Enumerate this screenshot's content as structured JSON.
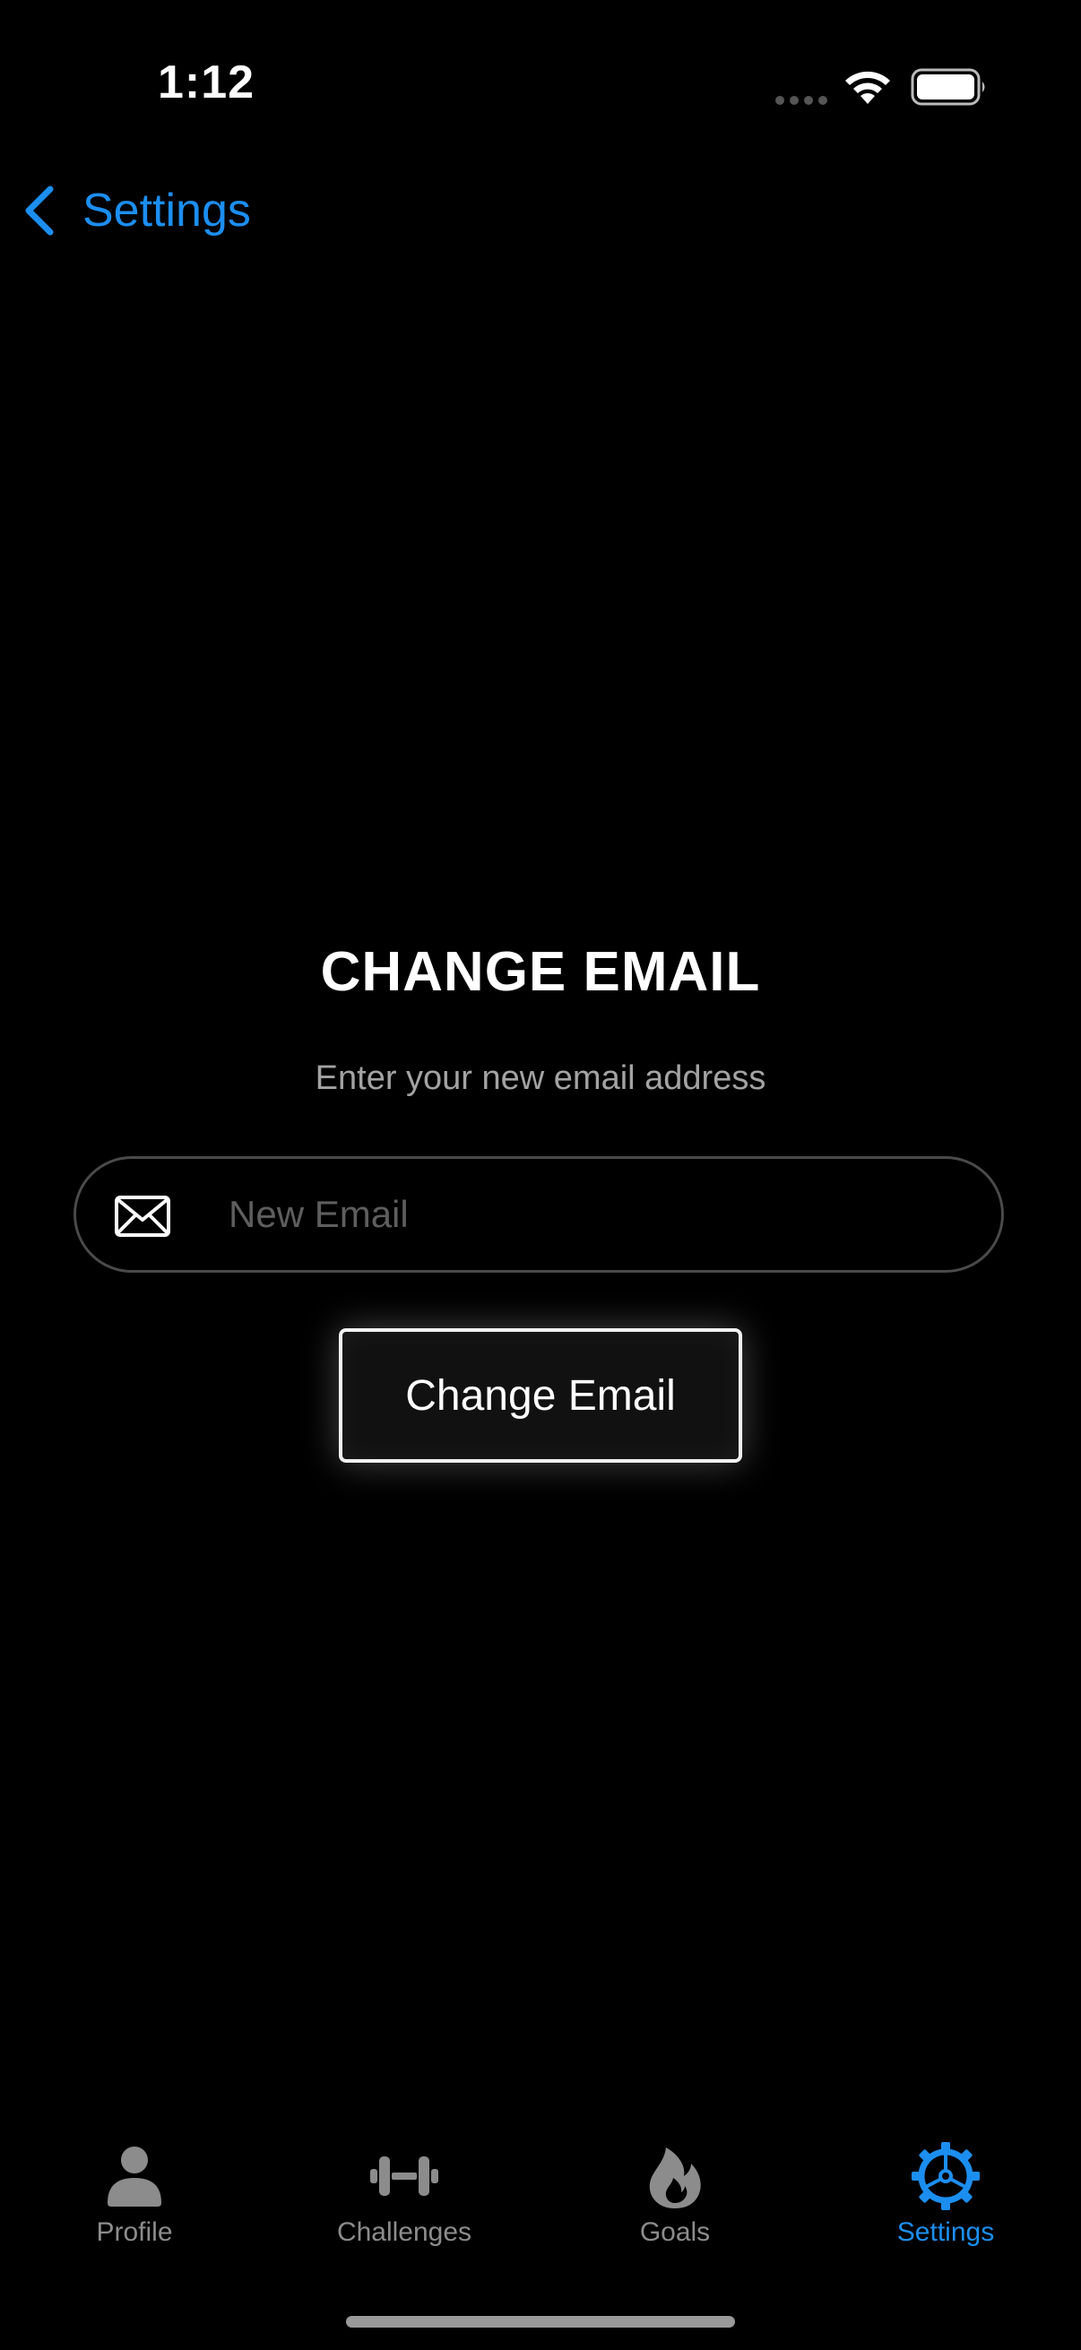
{
  "status_bar": {
    "time": "1:12"
  },
  "nav": {
    "back_label": "Settings"
  },
  "main": {
    "title": "CHANGE EMAIL",
    "subtitle": "Enter your new email address",
    "email_input": {
      "placeholder": "New Email",
      "value": ""
    },
    "submit_label": "Change Email"
  },
  "tab_bar": {
    "tabs": [
      {
        "label": "Profile",
        "icon": "person-icon",
        "active": false
      },
      {
        "label": "Challenges",
        "icon": "dumbbell-icon",
        "active": false
      },
      {
        "label": "Goals",
        "icon": "flame-icon",
        "active": false
      },
      {
        "label": "Settings",
        "icon": "gear-icon",
        "active": true
      }
    ]
  },
  "colors": {
    "accent": "#1c8ef0",
    "background": "#000000",
    "inactive_tab": "#8c8c8c",
    "subtitle": "#a3a3a3"
  }
}
